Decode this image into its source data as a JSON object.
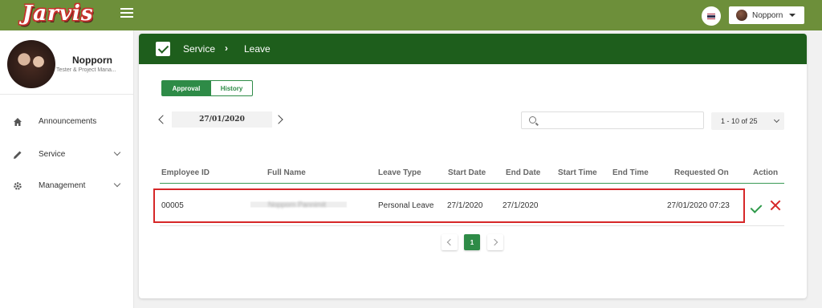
{
  "app": {
    "logo_text": "Jarvis",
    "brand_color": "#6d8f3a",
    "header_color": "#1e5e1c",
    "accent_color": "#2e8b47"
  },
  "topbar": {
    "user_name": "Nopporn",
    "language_icon": "flag-icon"
  },
  "sidebar": {
    "profile": {
      "name": "Nopporn",
      "role": "Tester & Project Mana..."
    },
    "items": [
      {
        "label": "Announcements",
        "icon": "home-icon"
      },
      {
        "label": "Service",
        "icon": "pencil-icon"
      },
      {
        "label": "Management",
        "icon": "gear-icon"
      }
    ]
  },
  "breadcrumb": {
    "service": "Service",
    "separator": "›",
    "leave": "Leave"
  },
  "tabs": {
    "approval": "Approval",
    "history": "History"
  },
  "date_picker": {
    "value": "27/01/2020"
  },
  "search": {
    "placeholder": "",
    "value": ""
  },
  "page_size": {
    "label": "1 - 10 of 25"
  },
  "table": {
    "columns": [
      "Employee ID",
      "Full Name",
      "Leave Type",
      "Start Date",
      "End Date",
      "Start Time",
      "End Time",
      "Requested On",
      "Action"
    ],
    "rows": [
      {
        "employee_id": "00005",
        "full_name": "Nopporn Pannimit",
        "leave_type": "Personal Leave",
        "start_date": "27/1/2020",
        "end_date": "27/1/2020",
        "start_time": "",
        "end_time": "",
        "requested_on": "27/01/2020 07:23"
      }
    ]
  },
  "pagination": {
    "current": "1"
  }
}
